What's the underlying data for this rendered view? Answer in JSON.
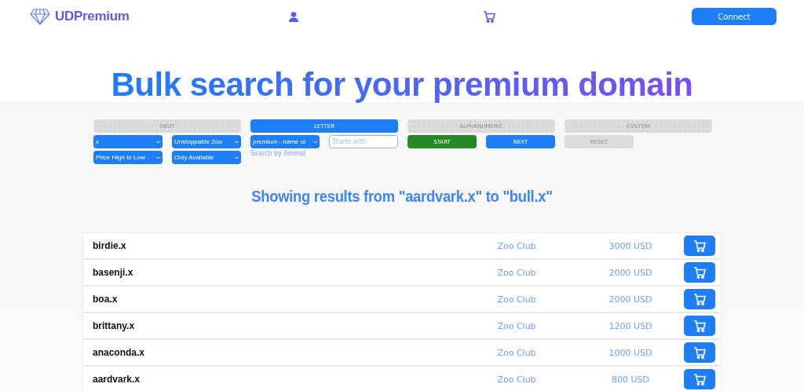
{
  "header": {
    "brand": "UDPremium",
    "connect": "Connect"
  },
  "title": "Bulk search for your premium domain",
  "tabs": [
    {
      "label": "DIGIT",
      "selected": false
    },
    {
      "label": "LETTER",
      "selected": true
    },
    {
      "label": "ALPHANUMERIC",
      "selected": false
    },
    {
      "label": "CUSTOM",
      "selected": false
    }
  ],
  "filters": {
    "extension": "x",
    "collection": "Unstoppable Zoo",
    "pattern": "premium - name or",
    "sort": "Price High to Low",
    "availability": "Only Available",
    "search": {
      "placeholder": "Starts with"
    },
    "hint": "Search by Animal"
  },
  "buttons": [
    {
      "label": "START",
      "kind": "start"
    },
    {
      "label": "NEXT",
      "kind": "next"
    },
    {
      "label": "RESET",
      "kind": "reset"
    }
  ],
  "results_heading": "Showing results from \"aardvark.x\" to \"bull.x\"",
  "results": [
    {
      "domain": "birdie.x",
      "club": "Zoo Club",
      "price": "3000 USD"
    },
    {
      "domain": "basenji.x",
      "club": "Zoo Club",
      "price": "2000 USD"
    },
    {
      "domain": "boa.x",
      "club": "Zoo Club",
      "price": "2000 USD"
    },
    {
      "domain": "brittany.x",
      "club": "Zoo Club",
      "price": "1200 USD"
    },
    {
      "domain": "anaconda.x",
      "club": "Zoo Club",
      "price": "1000 USD"
    },
    {
      "domain": "aardvark.x",
      "club": "Zoo Club",
      "price": "800 USD"
    }
  ]
}
